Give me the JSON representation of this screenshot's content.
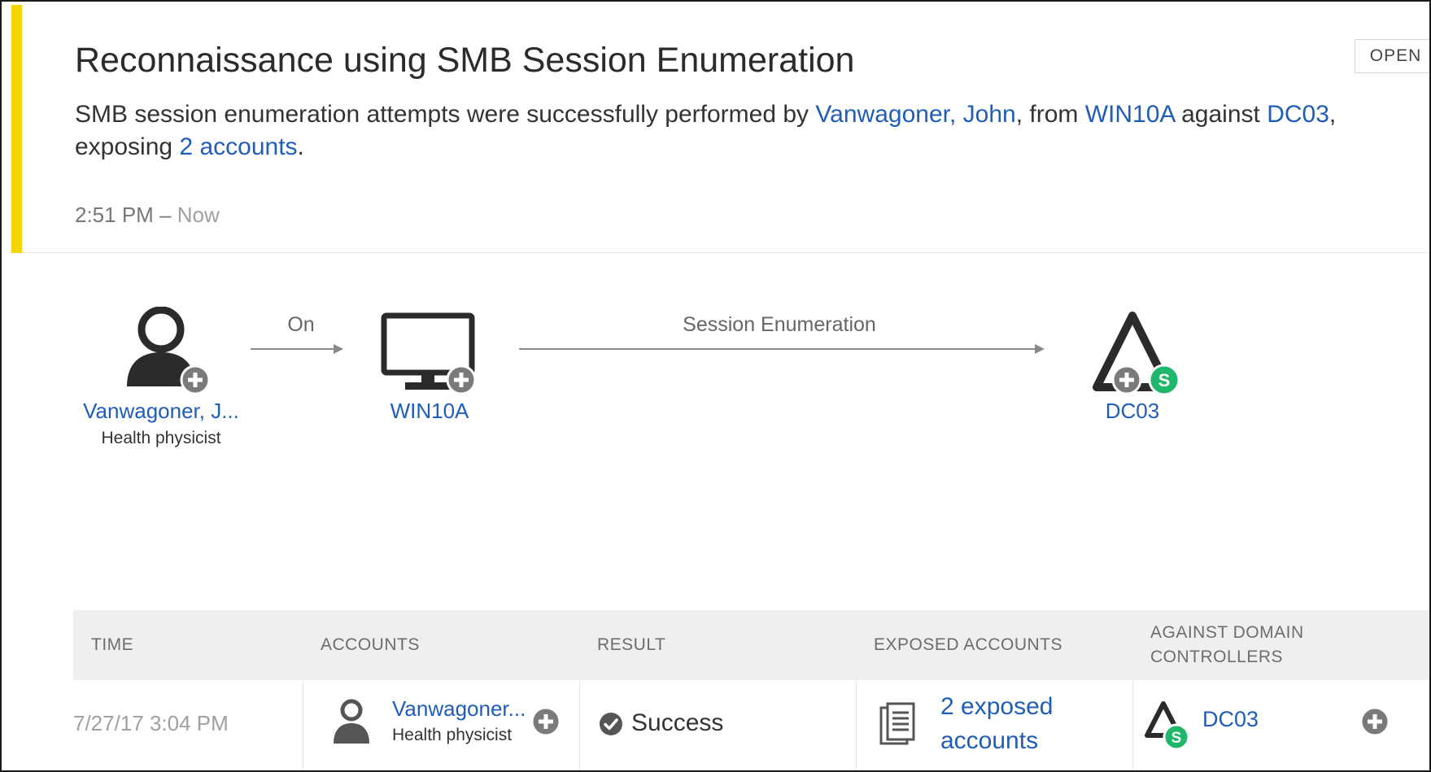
{
  "alert": {
    "title": "Reconnaissance using SMB Session Enumeration",
    "description": {
      "part1": "SMB session enumeration attempts were successfully performed by ",
      "user_link": "Vanwagoner, John",
      "part2": ", from ",
      "source_link": "WIN10A",
      "part3": " against ",
      "target_link": "DC03",
      "part4": ",",
      "part5": "exposing ",
      "accounts_link": "2 accounts",
      "part6": "."
    },
    "time_start": "2:51 PM",
    "time_sep": " – ",
    "time_end": "Now",
    "status_button": "OPEN",
    "accent_color": "#f6d500"
  },
  "diagram": {
    "user": {
      "label": "Vanwagoner, J...",
      "role": "Health physicist",
      "icon": "user-icon"
    },
    "edge1_label": "On",
    "computer": {
      "label": "WIN10A",
      "icon": "computer-icon"
    },
    "edge2_label": "Session Enumeration",
    "dc": {
      "label": "DC03",
      "icon": "domain-controller-icon",
      "badge": "S"
    }
  },
  "table": {
    "headers": {
      "time": "TIME",
      "accounts": "ACCOUNTS",
      "result": "RESULT",
      "exposed": "EXPOSED ACCOUNTS",
      "dc_line1": "AGAINST DOMAIN",
      "dc_line2": "CONTROLLERS"
    },
    "rows": [
      {
        "time": "7/27/17 3:04 PM",
        "account_name": "Vanwagoner...",
        "account_role": "Health physicist",
        "result": "Success",
        "exposed_line1": "2 exposed",
        "exposed_line2": "accounts",
        "dc": "DC03",
        "dc_badge": "S"
      }
    ]
  },
  "colors": {
    "link": "#1f5db8",
    "badge_green": "#1fb86a",
    "icon_dark": "#2b2b2b"
  }
}
